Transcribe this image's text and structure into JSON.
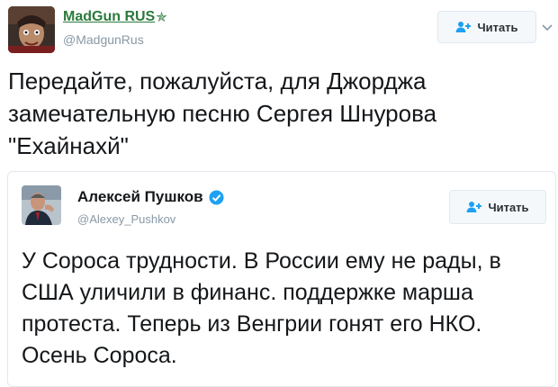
{
  "tweet": {
    "author_name": "MadGun RUS",
    "handle": "@MadgunRus",
    "follow_label": "Читать",
    "text": "Передайте, пожалуйста, для Джорджа замечательную песню Сергея Шнурова \"Ехайнахй\""
  },
  "quoted": {
    "author_name": "Алексей Пушков",
    "handle": "@Alexey_Pushkov",
    "follow_label": "Читать",
    "text": "У Сороса трудности. В России ему не рады, в США уличили в финанс. поддержке марша протеста. Теперь из Венгрии гонят его НКО. Осень Сороса."
  },
  "icons": {
    "author_badge": "star-icon",
    "verified": "verified-badge-icon",
    "follow": "add-user-icon",
    "menu": "chevron-down-icon"
  },
  "colors": {
    "author_name": "#2b7a3b",
    "link_blue": "#1da1f2",
    "muted": "#8899a6"
  }
}
